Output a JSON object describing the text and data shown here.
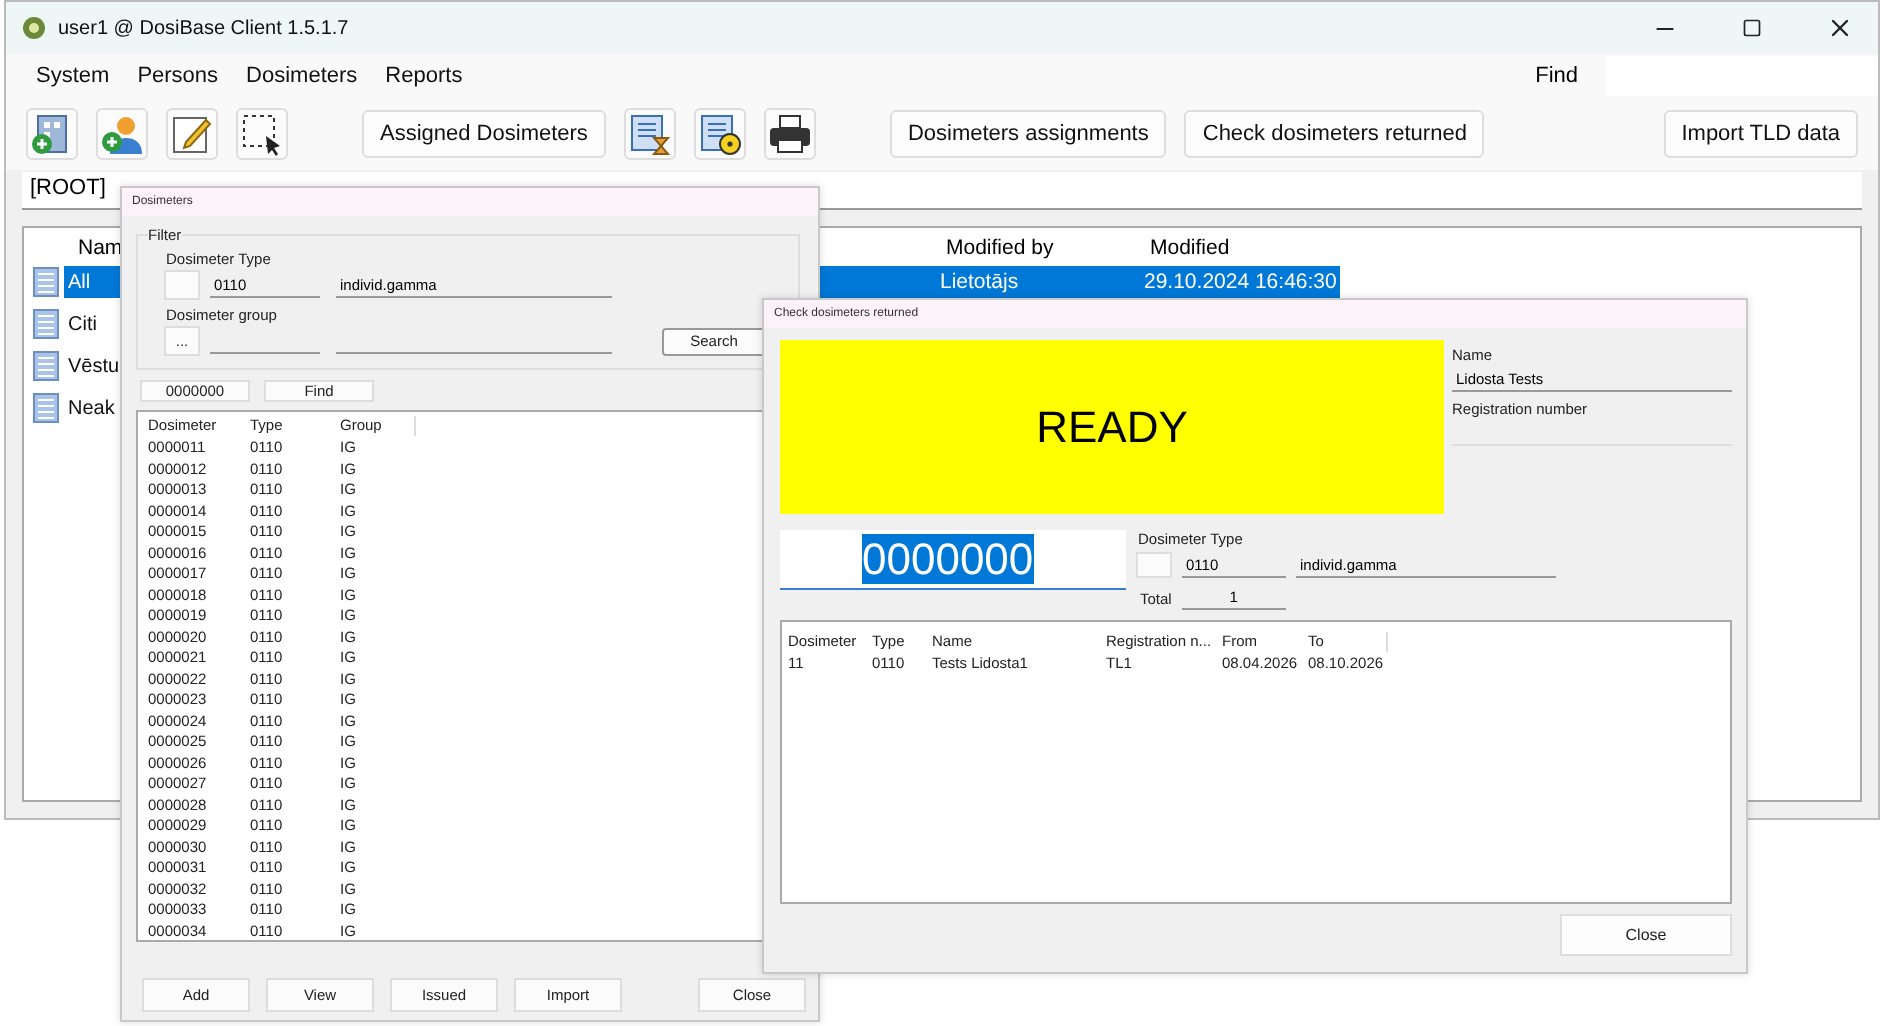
{
  "main_window": {
    "title": "user1 @ DosiBase Client 1.5.1.7",
    "menu": [
      "System",
      "Persons",
      "Dosimeters",
      "Reports"
    ],
    "find_label": "Find",
    "toolbar": [
      {
        "kind": "icon"
      },
      {
        "kind": "icon"
      },
      {
        "kind": "icon"
      },
      {
        "kind": "icon"
      },
      {
        "kind": "button",
        "label": "Assigned Dosimeters"
      },
      {
        "kind": "icon"
      },
      {
        "kind": "icon"
      },
      {
        "kind": "icon"
      },
      {
        "kind": "button",
        "label": "Dosimeters assignments"
      },
      {
        "kind": "button",
        "label": "Check dosimeters returned"
      }
    ],
    "toolbar_right_button": "Import TLD data",
    "path": "[ROOT]",
    "list": {
      "columns": [
        "Nam",
        "Modified by",
        "Modified"
      ],
      "rows": [
        {
          "name": "All",
          "modified_by": "Lietotājs",
          "modified": "29.10.2024 16:46:30",
          "selected": true
        },
        {
          "name": "Citi",
          "selected": false
        },
        {
          "name": "Vēstu",
          "selected": false
        },
        {
          "name": "Neak",
          "selected": false
        }
      ]
    }
  },
  "dosimeters_dialog": {
    "title": "Dosimeters",
    "filter_label": "Filter",
    "type_label": "Dosimeter Type",
    "type_code": "0110",
    "type_name": "individ.gamma",
    "group_label": "Dosimeter group",
    "group_button": "...",
    "search_button": "Search",
    "find_value": "0000000",
    "find_button": "Find",
    "columns": [
      "Dosimeter",
      "Type",
      "Group"
    ],
    "rows": [
      [
        "0000011",
        "0110",
        "IG"
      ],
      [
        "0000012",
        "0110",
        "IG"
      ],
      [
        "0000013",
        "0110",
        "IG"
      ],
      [
        "0000014",
        "0110",
        "IG"
      ],
      [
        "0000015",
        "0110",
        "IG"
      ],
      [
        "0000016",
        "0110",
        "IG"
      ],
      [
        "0000017",
        "0110",
        "IG"
      ],
      [
        "0000018",
        "0110",
        "IG"
      ],
      [
        "0000019",
        "0110",
        "IG"
      ],
      [
        "0000020",
        "0110",
        "IG"
      ],
      [
        "0000021",
        "0110",
        "IG"
      ],
      [
        "0000022",
        "0110",
        "IG"
      ],
      [
        "0000023",
        "0110",
        "IG"
      ],
      [
        "0000024",
        "0110",
        "IG"
      ],
      [
        "0000025",
        "0110",
        "IG"
      ],
      [
        "0000026",
        "0110",
        "IG"
      ],
      [
        "0000027",
        "0110",
        "IG"
      ],
      [
        "0000028",
        "0110",
        "IG"
      ],
      [
        "0000029",
        "0110",
        "IG"
      ],
      [
        "0000030",
        "0110",
        "IG"
      ],
      [
        "0000031",
        "0110",
        "IG"
      ],
      [
        "0000032",
        "0110",
        "IG"
      ],
      [
        "0000033",
        "0110",
        "IG"
      ],
      [
        "0000034",
        "0110",
        "IG"
      ]
    ],
    "buttons": [
      "Add",
      "View",
      "Issued",
      "Import"
    ],
    "close_button": "Close"
  },
  "check_dialog": {
    "title": "Check dosimeters returned",
    "status": "READY",
    "name_label": "Name",
    "name_value": "Lidosta Tests",
    "reg_label": "Registration number",
    "scan_value": "0000000",
    "type_label": "Dosimeter Type",
    "type_code": "0110",
    "type_name": "individ.gamma",
    "total_label": "Total",
    "total_value": "1",
    "columns": [
      "Dosimeter",
      "Type",
      "Name",
      "Registration n...",
      "From",
      "To"
    ],
    "rows": [
      [
        "11",
        "0110",
        "Tests Lidosta1",
        "TL1",
        "08.04.2026",
        "08.10.2026"
      ]
    ],
    "close_button": "Close"
  }
}
